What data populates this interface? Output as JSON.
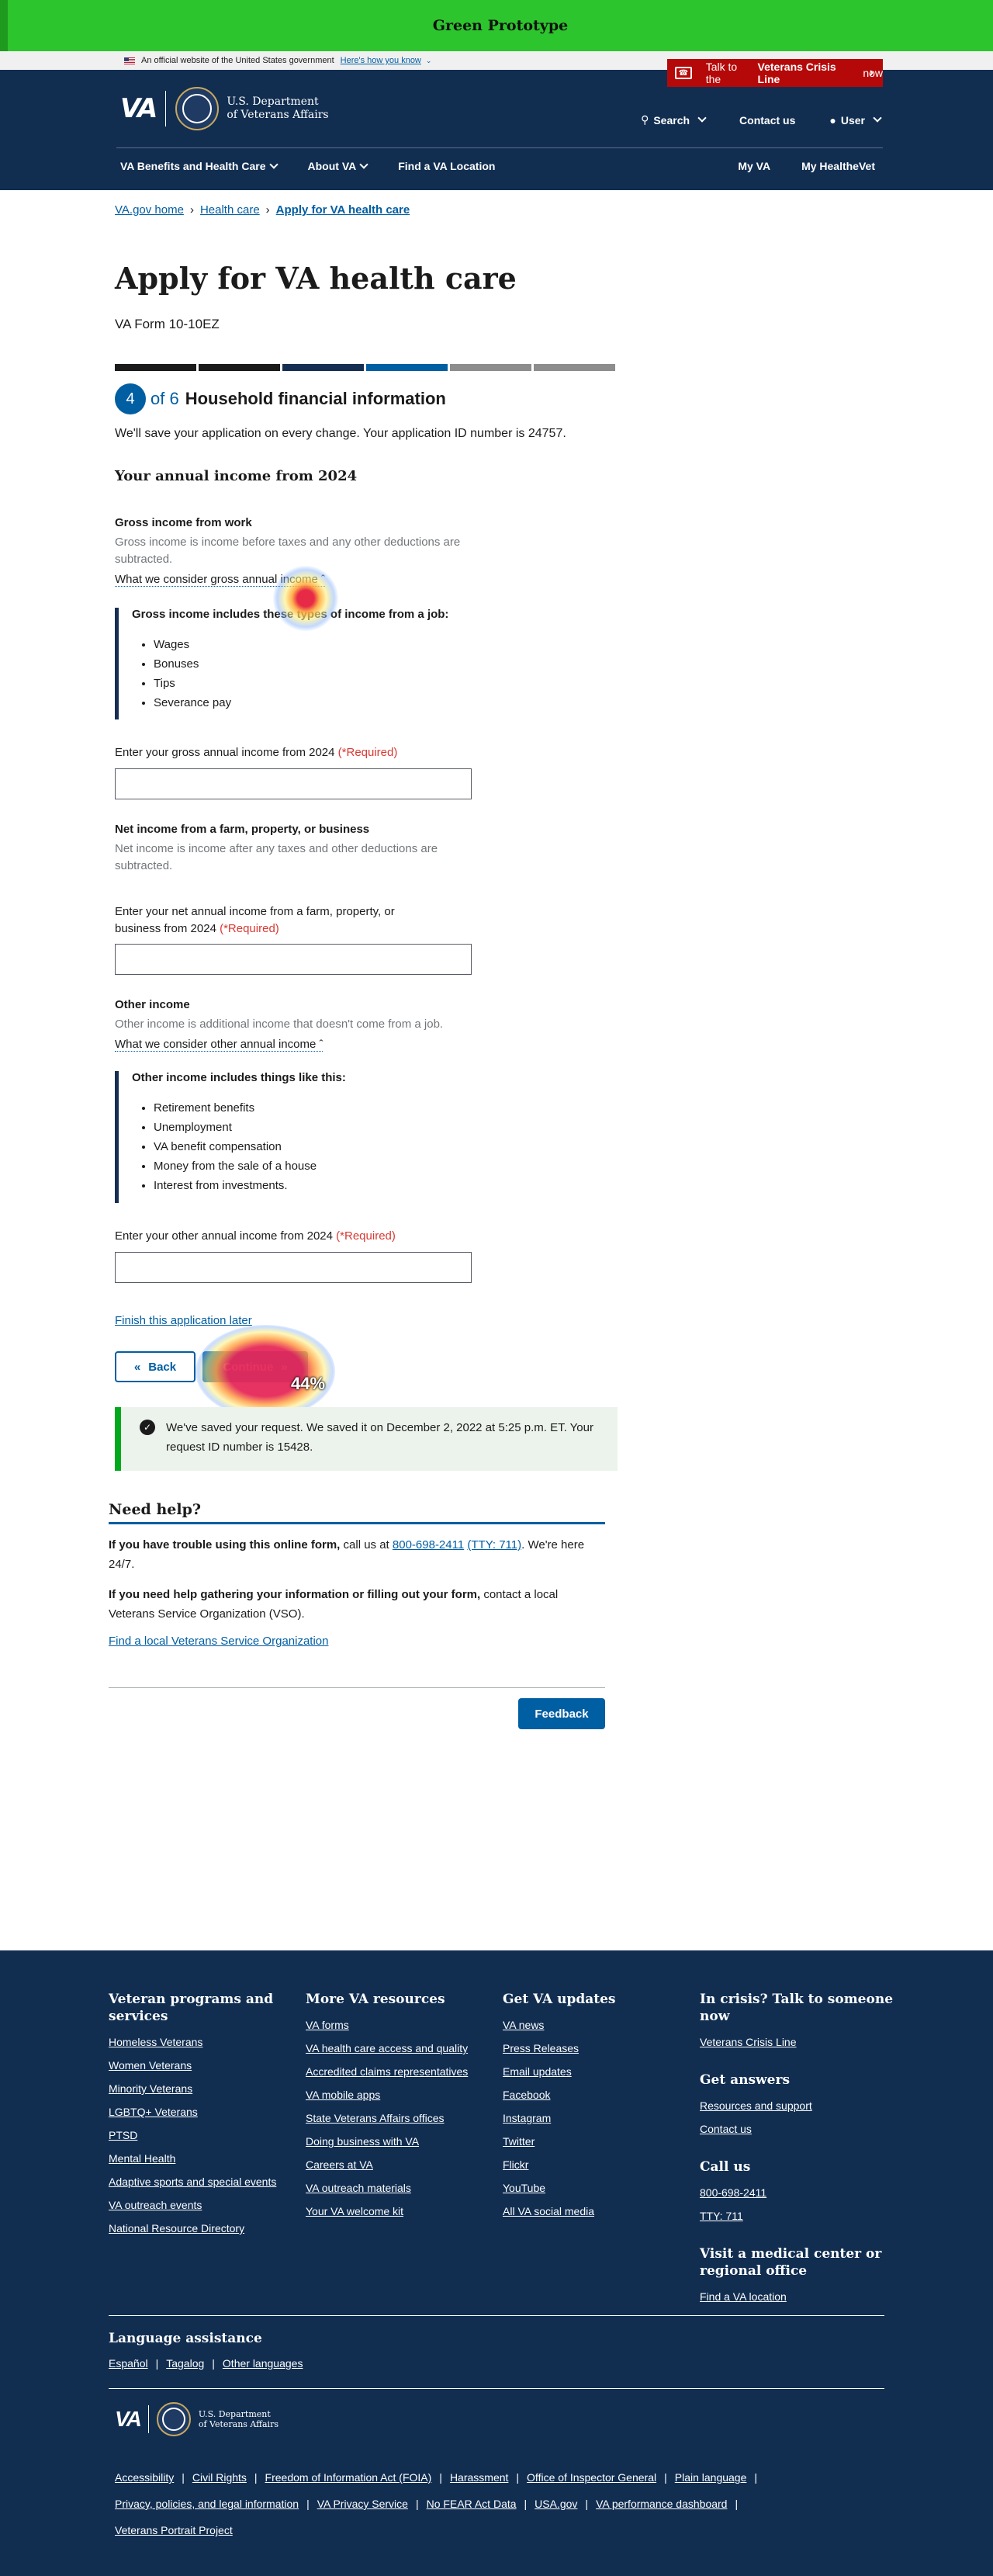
{
  "prototype_banner": "Green Prototype",
  "official": {
    "text": "An official website of the United States government",
    "link": "Here's how you know"
  },
  "crisis": {
    "pre": "Talk to the",
    "bold": "Veterans Crisis Line",
    "post": "now"
  },
  "logo": {
    "va": "VA",
    "dept_line1": "U.S. Department",
    "dept_line2": "of Veterans Affairs"
  },
  "header_nav": {
    "search": "Search",
    "contact": "Contact us",
    "user": "User"
  },
  "main_nav": {
    "benefits": "VA Benefits and Health Care",
    "about": "About VA",
    "find": "Find a VA Location",
    "myva": "My VA",
    "healthevet": "My HealtheVet"
  },
  "breadcrumb": [
    "VA.gov home",
    "Health care",
    "Apply for VA health care"
  ],
  "page": {
    "title": "Apply for VA health care",
    "form_number": "VA Form 10-10EZ",
    "step_current": "4",
    "step_of": "of 6",
    "step_title": "Household financial information",
    "save_note": "We'll save your application on every change. Your application ID number is 24757.",
    "section_title": "Your annual income from 2024"
  },
  "progress_colors": [
    "#1b1b1b",
    "#1b1b1b",
    "#162e51",
    "#005ea2",
    "#8d8d8d",
    "#8d8d8d"
  ],
  "gross": {
    "label": "Gross income from work",
    "hint": "Gross income is income before taxes and any other deductions are subtracted.",
    "toggle": "What we consider gross annual income",
    "info_title": "Gross income includes these types of income from a job:",
    "items": [
      "Wages",
      "Bonuses",
      "Tips",
      "Severance pay"
    ],
    "field_label": "Enter your gross annual income from 2024",
    "required": "(*Required)"
  },
  "net": {
    "label": "Net income from a farm, property, or business",
    "hint": "Net income is income after any taxes and other deductions are subtracted.",
    "field_label": "Enter your net annual income from a farm, property, or business from 2024",
    "required": "(*Required)"
  },
  "other": {
    "label": "Other income",
    "hint": "Other income is additional income that doesn't come from a job.",
    "toggle": "What we consider other annual income",
    "info_title": "Other income includes things like this:",
    "items": [
      "Retirement benefits",
      "Unemployment",
      "VA benefit compensation",
      "Money from the sale of a house",
      "Interest from investments."
    ],
    "field_label": "Enter your other annual income from 2024",
    "required": "(*Required)"
  },
  "actions": {
    "finish_later": "Finish this application later",
    "back": "Back",
    "continue": "Continue"
  },
  "alert": "We've saved your request. We saved it on December 2, 2022 at 5:25 p.m. ET. Your request ID number is 15428.",
  "help": {
    "title": "Need help?",
    "p1_bold": "If you have trouble using this online form,",
    "p1_mid": " call us at ",
    "phone": "800-698-2411",
    "tty": "(TTY: 711)",
    "p1_end": ". We're here 24/7.",
    "p2_bold": "If you need help gathering your information or filling out your form,",
    "p2_rest": " contact a local Veterans Service Organization (VSO).",
    "vso_link": "Find a local Veterans Service Organization",
    "feedback": "Feedback"
  },
  "heatmap_label": "44%",
  "footer": {
    "col1": {
      "title": "Veteran programs and services",
      "links": [
        "Homeless Veterans",
        "Women Veterans",
        "Minority Veterans",
        "LGBTQ+ Veterans",
        "PTSD",
        "Mental Health",
        "Adaptive sports and special events",
        "VA outreach events",
        "National Resource Directory"
      ]
    },
    "col2": {
      "title": "More VA resources",
      "links": [
        "VA forms",
        "VA health care access and quality",
        "Accredited claims representatives",
        "VA mobile apps",
        "State Veterans Affairs offices",
        "Doing business with VA",
        "Careers at VA",
        "VA outreach materials",
        "Your VA welcome kit"
      ]
    },
    "col3": {
      "title": "Get VA updates",
      "links": [
        "VA news",
        "Press Releases",
        "Email updates",
        "Facebook",
        "Instagram",
        "Twitter",
        "Flickr",
        "YouTube",
        "All VA social media"
      ]
    },
    "col4": {
      "crisis_title": "In crisis? Talk to someone now",
      "crisis_link": "Veterans Crisis Line",
      "answers_title": "Get answers",
      "answers_links": [
        "Resources and support",
        "Contact us"
      ],
      "call_title": "Call us",
      "call_links": [
        "800-698-2411",
        "TTY: 711"
      ],
      "visit_title": "Visit a medical center or regional office",
      "visit_link": "Find a VA location"
    },
    "language_title": "Language assistance",
    "languages": [
      "Español",
      "Tagalog",
      "Other languages"
    ],
    "legal": [
      "Accessibility",
      "Civil Rights",
      "Freedom of Information Act (FOIA)",
      "Harassment",
      "Office of Inspector General",
      "Plain language",
      "Privacy, policies, and legal information",
      "VA Privacy Service",
      "No FEAR Act Data",
      "USA.gov",
      "VA performance dashboard",
      "Veterans Portrait Project"
    ]
  }
}
